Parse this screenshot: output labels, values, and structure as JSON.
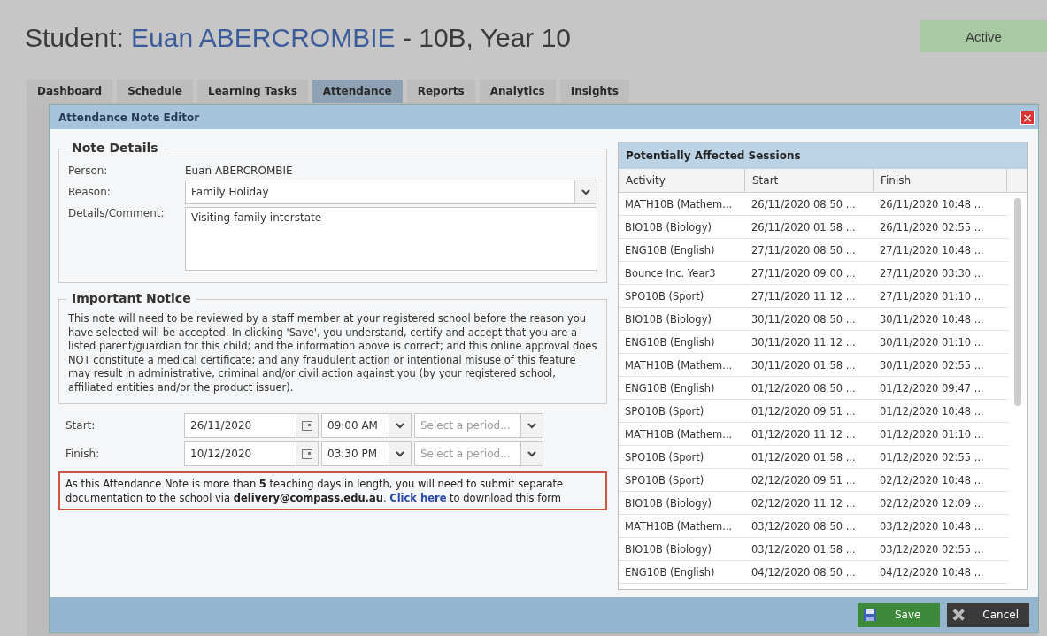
{
  "page_title": {
    "label": "Student:",
    "name": "Euan ABERCROMBIE",
    "suffix": "- 10B, Year 10"
  },
  "status_badge": "Active",
  "tabs": [
    {
      "label": "Dashboard",
      "selected": false
    },
    {
      "label": "Schedule",
      "selected": false
    },
    {
      "label": "Learning Tasks",
      "selected": false
    },
    {
      "label": "Attendance",
      "selected": true
    },
    {
      "label": "Reports",
      "selected": false
    },
    {
      "label": "Analytics",
      "selected": false
    },
    {
      "label": "Insights",
      "selected": false
    }
  ],
  "dialog": {
    "title": "Attendance Note Editor",
    "close": "×",
    "note_details": {
      "legend": "Note Details",
      "person_label": "Person:",
      "person": "Euan ABERCROMBIE",
      "reason_label": "Reason:",
      "reason": "Family Holiday",
      "comment_label": "Details/Comment:",
      "comment": "Visiting family interstate"
    },
    "notice": {
      "legend": "Important Notice",
      "text": "This note will need to be reviewed by a staff member at your registered school before the reason you have selected will be accepted. In clicking 'Save', you understand, certify and accept that you are a listed parent/guardian for this child; and the information above is correct; and this online approval does NOT constitute a medical certificate; and any fraudulent action or intentional misuse of this feature may result in administrative, criminal and/or civil action against you (by your registered school, affiliated entities and/or the product issuer)."
    },
    "times": [
      {
        "label": "Start:",
        "date": "26/11/2020",
        "time": "09:00 AM",
        "period_placeholder": "Select a period..."
      },
      {
        "label": "Finish:",
        "date": "10/12/2020",
        "time": "03:30 PM",
        "period_placeholder": "Select a period..."
      }
    ],
    "warning": {
      "text": "As this Attendance Note is more than **5** teaching days in length, you will need to submit separate documentation to the school via **delivery@compass.edu.au**.",
      "link": "Click here",
      "text_after": "to download this form"
    },
    "sessions": {
      "title": "Potentially Affected Sessions",
      "columns": [
        "Activity",
        "Start",
        "Finish"
      ],
      "rows": [
        [
          "MATH10B (Mathem...",
          "26/11/2020 08:50 ...",
          "26/11/2020 10:48 ..."
        ],
        [
          "BIO10B (Biology)",
          "26/11/2020 01:58 ...",
          "26/11/2020 02:55 ..."
        ],
        [
          "ENG10B (English)",
          "27/11/2020 08:50 ...",
          "27/11/2020 10:48 ..."
        ],
        [
          "Bounce Inc. Year3",
          "27/11/2020 09:00 ...",
          "27/11/2020 03:30 ..."
        ],
        [
          "SPO10B (Sport)",
          "27/11/2020 11:12 ...",
          "27/11/2020 01:10 ..."
        ],
        [
          "BIO10B (Biology)",
          "30/11/2020 08:50 ...",
          "30/11/2020 10:48 ..."
        ],
        [
          "ENG10B (English)",
          "30/11/2020 11:12 ...",
          "30/11/2020 01:10 ..."
        ],
        [
          "MATH10B (Mathem...",
          "30/11/2020 01:58 ...",
          "30/11/2020 02:55 ..."
        ],
        [
          "ENG10B (English)",
          "01/12/2020 08:50 ...",
          "01/12/2020 09:47 ..."
        ],
        [
          "SPO10B (Sport)",
          "01/12/2020 09:51 ...",
          "01/12/2020 10:48 ..."
        ],
        [
          "MATH10B (Mathem...",
          "01/12/2020 11:12 ...",
          "01/12/2020 01:10 ..."
        ],
        [
          "SPO10B (Sport)",
          "01/12/2020 01:58 ...",
          "01/12/2020 02:55 ..."
        ],
        [
          "SPO10B (Sport)",
          "02/12/2020 09:51 ...",
          "02/12/2020 10:48 ..."
        ],
        [
          "BIO10B (Biology)",
          "02/12/2020 11:12 ...",
          "02/12/2020 12:09 ..."
        ],
        [
          "MATH10B (Mathem...",
          "03/12/2020 08:50 ...",
          "03/12/2020 10:48 ..."
        ],
        [
          "BIO10B (Biology)",
          "03/12/2020 01:58 ...",
          "03/12/2020 02:55 ..."
        ],
        [
          "ENG10B (English)",
          "04/12/2020 08:50 ...",
          "04/12/2020 10:48 ..."
        ]
      ]
    },
    "buttons": [
      {
        "kind": "save",
        "label": "Save"
      },
      {
        "kind": "cancel",
        "label": "Cancel"
      }
    ]
  }
}
